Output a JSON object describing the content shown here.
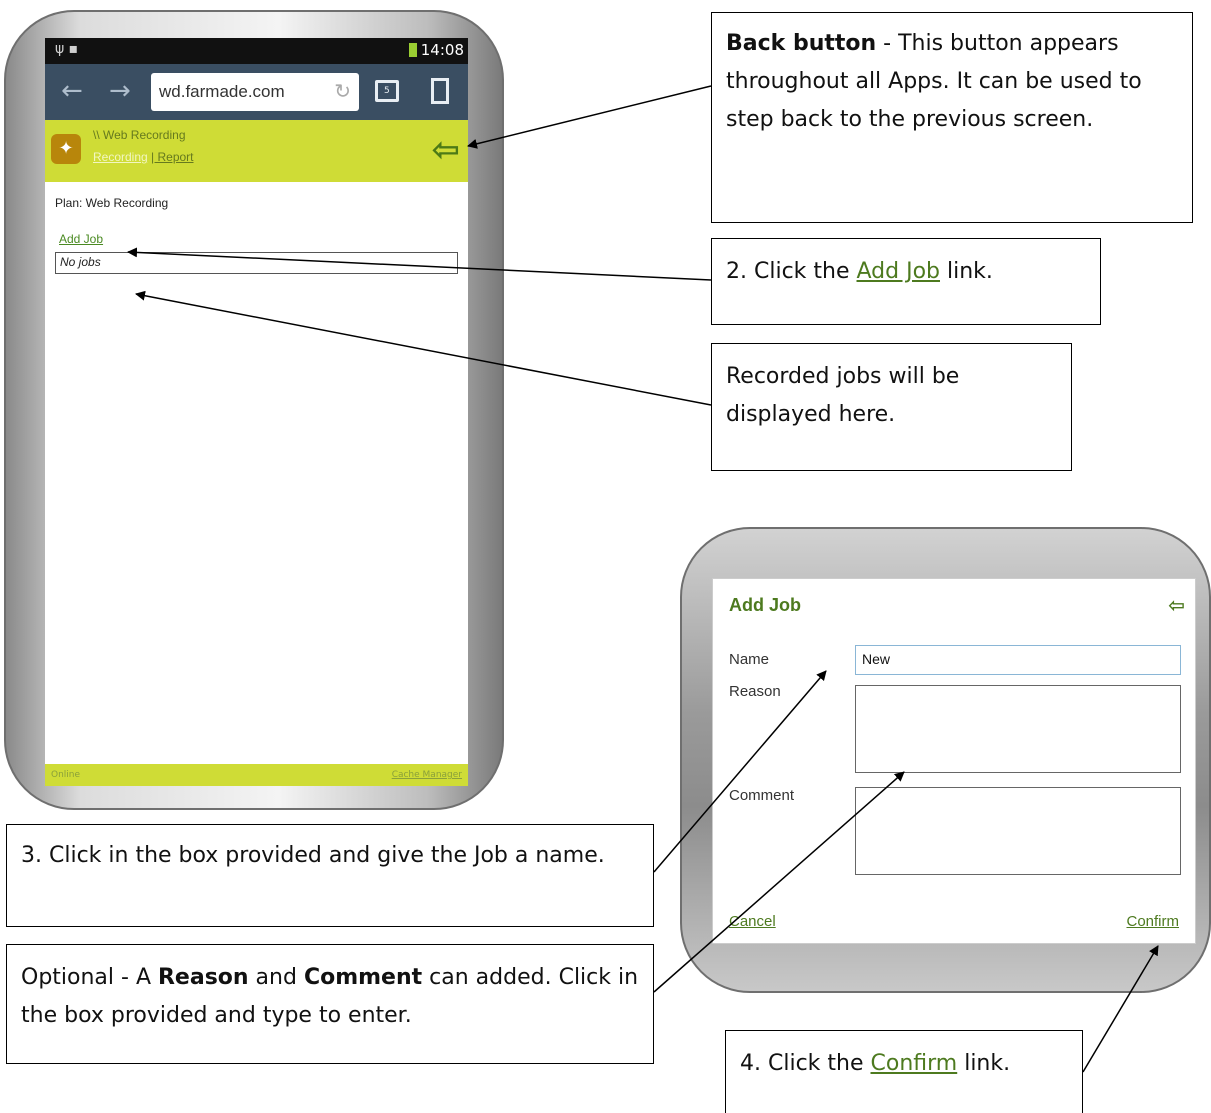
{
  "phone": {
    "status_time": "14:08",
    "url": "wd.farmade.com",
    "app_breadcrumb": "\\\\ Web Recording",
    "nav_current": "Recording",
    "nav_other": "| Report",
    "plan_label": "Plan: Web Recording",
    "add_job_link": "Add Job",
    "jobs_placeholder": "No jobs",
    "footer_status": "Online",
    "footer_link": "Cache Manager"
  },
  "callouts": {
    "back_title": "Back button",
    "back_text": " - This button appears throughout all Apps. It can be used to step back to the previous screen.",
    "step2_prefix": "2. Click the ",
    "step2_link": "Add Job",
    "step2_suffix": " link.",
    "recorded": "Recorded jobs will be displayed here.",
    "step3": "3. Click in the box provided and give the Job a name.",
    "optional_prefix": "Optional - A ",
    "optional_reason": "Reason",
    "optional_and": " and ",
    "optional_comment": "Comment",
    "optional_suffix": " can added. Click in the box provided and type to enter.",
    "step4_prefix": "4. Click the ",
    "step4_link": "Confirm",
    "step4_suffix": " link."
  },
  "dialog": {
    "title": "Add Job",
    "name_label": "Name",
    "name_value": "New",
    "reason_label": "Reason",
    "comment_label": "Comment",
    "cancel": "Cancel",
    "confirm": "Confirm"
  },
  "colors": {
    "app_green": "#cfdc36",
    "link_green": "#4d7a1f",
    "urlbar": "#3a4e62"
  }
}
